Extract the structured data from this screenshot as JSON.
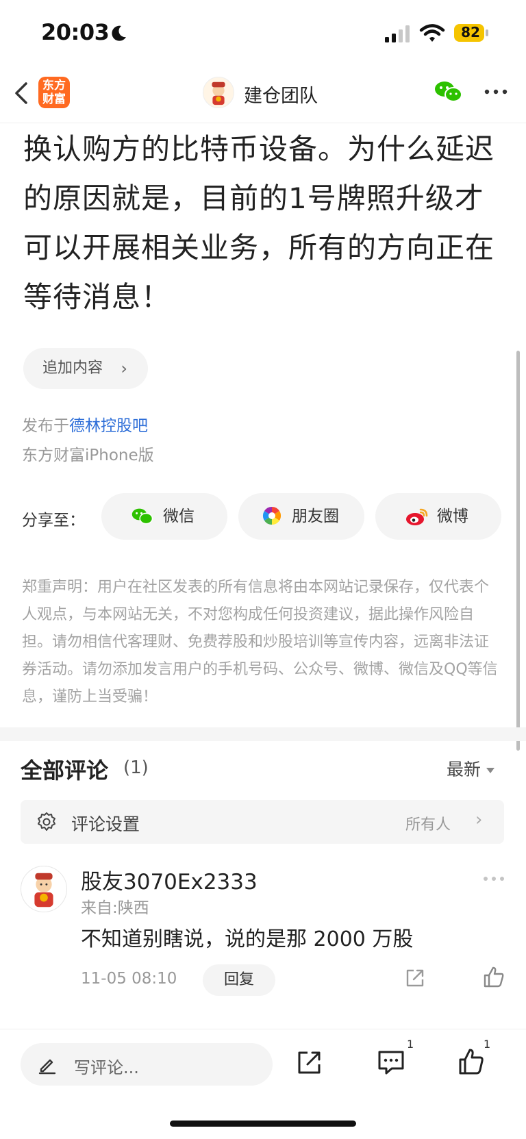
{
  "status_bar": {
    "time": "20:03",
    "battery": "82",
    "icons": [
      "moon-icon",
      "signal-icon",
      "wifi-icon",
      "battery-icon"
    ]
  },
  "nav": {
    "logo_text": "东方\n财富",
    "team_name": "建仓团队",
    "icons": [
      "back-icon",
      "wechat-icon",
      "more-icon"
    ],
    "brand_color": "#ff6a21"
  },
  "article": {
    "text": "换认购方的比特币设备。为什么延迟的原因就是，目前的1号牌照升级才可以开展相关业务，所有的方向正在等待消息！",
    "append_label": "追加内容",
    "published_prefix": "发布于",
    "published_board": "德林控股吧",
    "device": "东方财富iPhone版"
  },
  "share": {
    "label": "分享至：",
    "targets": [
      {
        "name": "微信",
        "icon": "wechat-icon"
      },
      {
        "name": "朋友圈",
        "icon": "moments-icon"
      },
      {
        "name": "微博",
        "icon": "weibo-icon"
      }
    ]
  },
  "disclaimer": "郑重声明：用户在社区发表的所有信息将由本网站记录保存，仅代表个人观点，与本网站无关，不对您构成任何投资建议，据此操作风险自担。请勿相信代客理财、免费荐股和炒股培训等宣传内容，远离非法证券活动。请勿添加发言用户的手机号码、公众号、微博、微信及QQ等信息，谨防上当受骗！",
  "comments": {
    "title": "全部评论",
    "count": "(1)",
    "sort": "最新",
    "settings_label": "评论设置",
    "settings_value": "所有人",
    "items": [
      {
        "user": "股友3070Ex2333",
        "location": "来自:陕西",
        "text": "不知道别瞎说，说的是那 2000 万股",
        "time": "11-05 08:10",
        "reply_label": "回复"
      }
    ]
  },
  "bottom_bar": {
    "placeholder": "写评论...",
    "comment_count": "1",
    "like_count": "1"
  },
  "colors": {
    "link": "#2f6fd8",
    "wechat_green": "#2dc100",
    "weibo_red": "#e6162d"
  }
}
